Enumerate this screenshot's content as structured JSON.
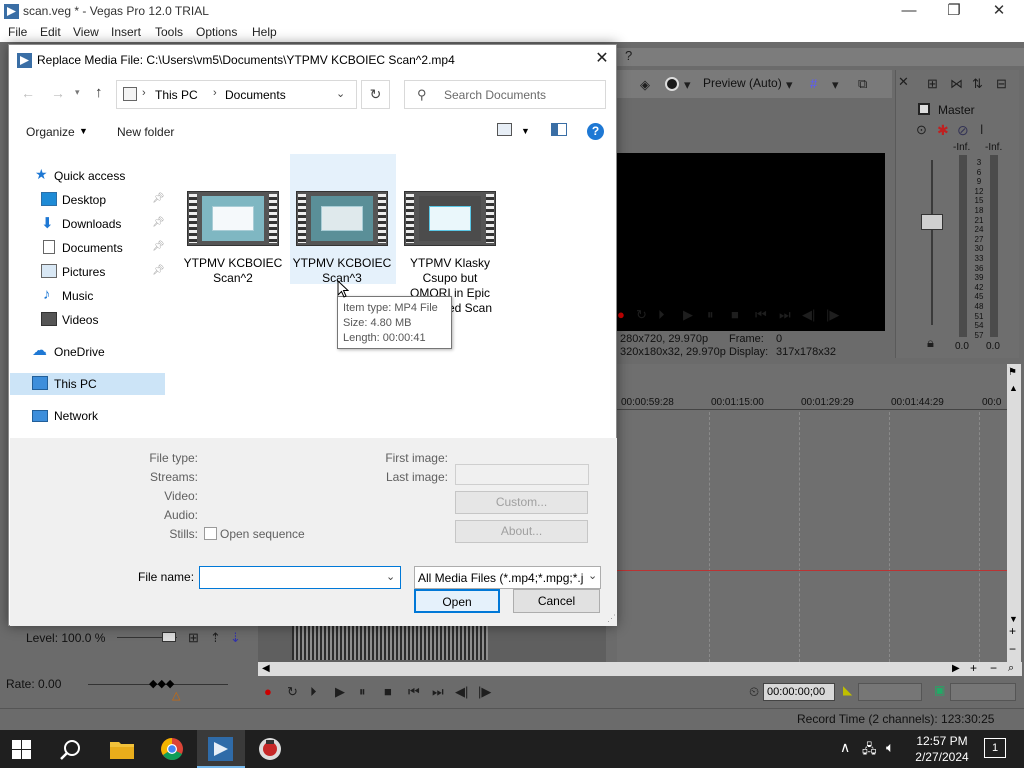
{
  "app": {
    "title": "scan.veg * - Vegas Pro 12.0 TRIAL",
    "menu": [
      "File",
      "Edit",
      "View",
      "Insert",
      "Tools",
      "Options",
      "Help"
    ],
    "window_buttons": {
      "minimize": "—",
      "maximize": "❐",
      "close": "✕"
    }
  },
  "vegas": {
    "preview_mode": "Preview (Auto)",
    "master_label": "Master",
    "meter_inf_left": "-Inf.",
    "meter_inf_right": "-Inf.",
    "meter_scale": [
      "3",
      "6",
      "9",
      "12",
      "15",
      "18",
      "21",
      "24",
      "27",
      "30",
      "33",
      "36",
      "39",
      "42",
      "45",
      "48",
      "51",
      "54",
      "57"
    ],
    "meter_val_left": "0.0",
    "meter_val_right": "0.0",
    "project_res": "280x720, 29.970p",
    "preview_res": "320x180x32, 29.970p",
    "frame_label": "Frame:",
    "frame_value": "0",
    "display_label": "Display:",
    "display_value": "317x178x32",
    "timeline_ticks": [
      "00:00:59:28",
      "00:01:15:00",
      "00:01:29:29",
      "00:01:44:29",
      "00:0"
    ],
    "level_text": "Level: 100.0 %",
    "rate_text": "Rate: 0.00",
    "timecode": "00:00:00;00",
    "record_time": "Record Time (2 channels): 123:30:25"
  },
  "dialog": {
    "title": "Replace Media File: C:\\Users\\vm5\\Documents\\YTPMV KCBOIEC Scan^2.mp4",
    "breadcrumb": [
      "This PC",
      "Documents"
    ],
    "search_placeholder": "Search Documents",
    "organize_label": "Organize",
    "new_folder_label": "New folder",
    "nav": {
      "quick_access": "Quick access",
      "desktop": "Desktop",
      "downloads": "Downloads",
      "documents": "Documents",
      "pictures": "Pictures",
      "music": "Music",
      "videos": "Videos",
      "onedrive": "OneDrive",
      "this_pc": "This PC",
      "network": "Network"
    },
    "files": [
      {
        "line1": "YTPMV KCBOIEC",
        "line2": "Scan^2"
      },
      {
        "line1": "YTPMV KCBOIEC",
        "line2": "Scan^3"
      },
      {
        "line1": "YTPMV Klasky",
        "line2": "Csupo but",
        "line3": "OMORI in Epic",
        "line4": "ed Scan"
      }
    ],
    "tooltip": {
      "type": "Item type: MP4 File",
      "size": "Size: 4.80 MB",
      "length": "Length: 00:00:41"
    },
    "details": {
      "file_type": "File type:",
      "streams": "Streams:",
      "video": "Video:",
      "audio": "Audio:",
      "stills": "Stills:",
      "open_sequence": "Open sequence",
      "first_image": "First image:",
      "last_image": "Last image:",
      "custom_btn": "Custom...",
      "about_btn": "About..."
    },
    "file_name_label": "File name:",
    "file_name_value": "",
    "filter_value": "All Media Files (*.mp4;*.mpg;*.j",
    "open_btn": "Open",
    "cancel_btn": "Cancel"
  },
  "taskbar": {
    "time": "12:57 PM",
    "date": "2/27/2024",
    "notification_count": "1"
  }
}
